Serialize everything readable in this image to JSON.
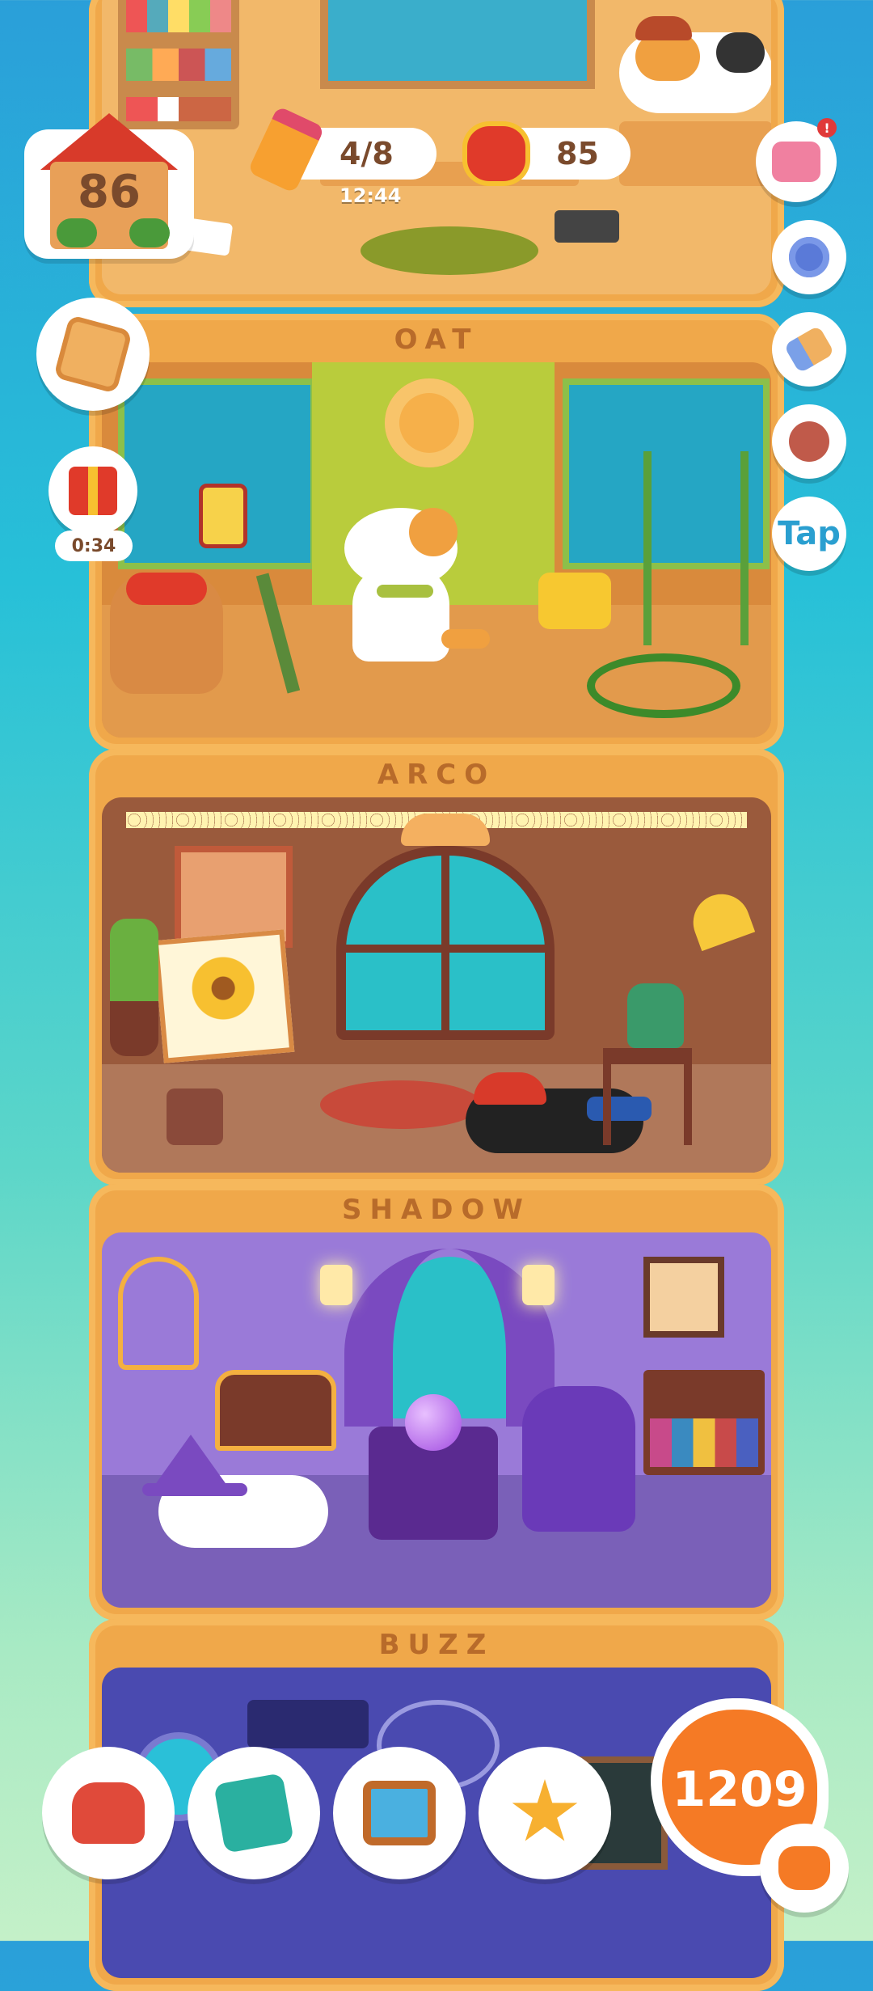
{
  "hud": {
    "home_level": "86",
    "pencil_count": "4/8",
    "clock": "12:44",
    "food_count": "85",
    "gift_timer": "0:34",
    "tap_label": "Tap",
    "coins": "1209"
  },
  "rooms": [
    {
      "name": "OAT"
    },
    {
      "name": "ARCO"
    },
    {
      "name": "SHADOW"
    },
    {
      "name": "BUZZ"
    }
  ],
  "side_buttons": [
    "shop-bow-icon",
    "gear-icon",
    "paint-brush-icon",
    "stamp-icon",
    "tap-button"
  ],
  "bottom_nav": [
    "furniture-armchair-icon",
    "paw-book-icon",
    "photo-frame-icon",
    "star-lamp-icon",
    "cat-coins-icon"
  ],
  "colors": {
    "accent": "#f57a25",
    "wood": "#f0a84a",
    "sign_text": "#b86b2a"
  }
}
